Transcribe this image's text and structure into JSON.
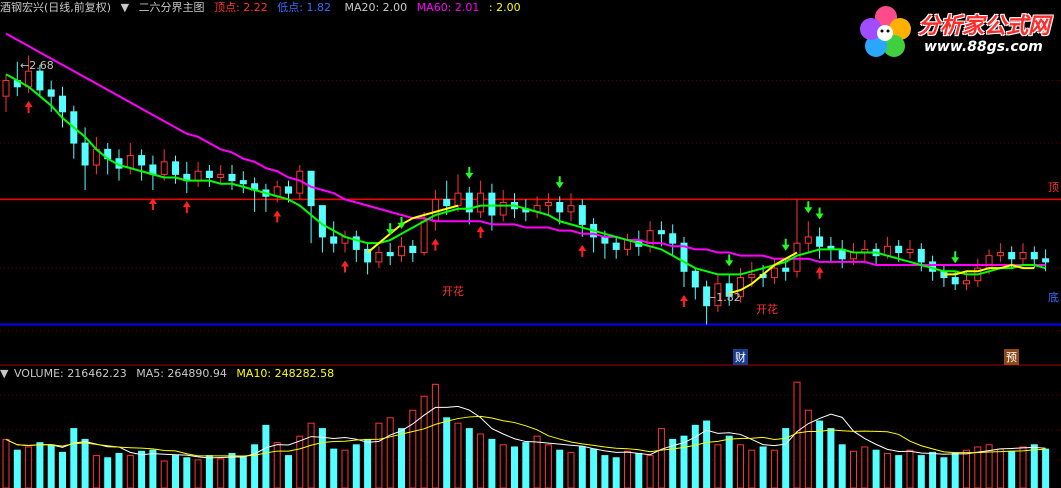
{
  "header": {
    "stock": "酒钢宏兴(日线,前复权)",
    "indicator": "二六分界主图",
    "top_label": "顶点: 2.22",
    "bottom_label": "低点: 1.82",
    "ma20_label": "MA20: 2.00",
    "ma60_label": "MA60: 2.01",
    "extra_label": ": 2.00"
  },
  "logo": {
    "title": "分析家公式网",
    "url": "www.88gs.com"
  },
  "annotations": {
    "high_price": "2.68",
    "low_price": "1.82",
    "kaihua_1": "开花",
    "kaihua_2": "开花",
    "top_tag": "顶",
    "bottom_tag": "底",
    "cai": "财",
    "yu": "预"
  },
  "volume_header": {
    "volume": "VOLUME: 216462.23",
    "ma5": "MA5: 264890.94",
    "ma10": "MA10: 248282.58"
  },
  "colors": {
    "up": "#ff3232",
    "down": "#54ffff",
    "ma20": "#00ff00",
    "ma60": "#ff00ff",
    "yellow_line": "#ffff00",
    "top_line": "#ff0000",
    "bottom_line": "#0000ff"
  },
  "chart_data": {
    "type": "candlestick",
    "ylim": [
      1.7,
      2.8
    ],
    "top_level": 2.22,
    "bottom_level": 1.82,
    "candles": [
      [
        2.55,
        2.6,
        2.5,
        2.62
      ],
      [
        2.6,
        2.58,
        2.55,
        2.66
      ],
      [
        2.58,
        2.63,
        2.56,
        2.68
      ],
      [
        2.63,
        2.57,
        2.55,
        2.65
      ],
      [
        2.57,
        2.55,
        2.5,
        2.6
      ],
      [
        2.55,
        2.5,
        2.45,
        2.58
      ],
      [
        2.5,
        2.4,
        2.35,
        2.52
      ],
      [
        2.4,
        2.33,
        2.25,
        2.45
      ],
      [
        2.33,
        2.38,
        2.3,
        2.42
      ],
      [
        2.38,
        2.35,
        2.3,
        2.4
      ],
      [
        2.35,
        2.32,
        2.28,
        2.38
      ],
      [
        2.32,
        2.36,
        2.3,
        2.4
      ],
      [
        2.36,
        2.33,
        2.28,
        2.38
      ],
      [
        2.33,
        2.3,
        2.25,
        2.36
      ],
      [
        2.3,
        2.34,
        2.28,
        2.38
      ],
      [
        2.34,
        2.3,
        2.27,
        2.36
      ],
      [
        2.3,
        2.28,
        2.24,
        2.34
      ],
      [
        2.28,
        2.31,
        2.26,
        2.34
      ],
      [
        2.31,
        2.29,
        2.26,
        2.33
      ],
      [
        2.29,
        2.3,
        2.27,
        2.33
      ],
      [
        2.3,
        2.28,
        2.25,
        2.33
      ],
      [
        2.28,
        2.27,
        2.24,
        2.31
      ],
      [
        2.27,
        2.25,
        2.18,
        2.29
      ],
      [
        2.25,
        2.23,
        2.18,
        2.27
      ],
      [
        2.23,
        2.26,
        2.21,
        2.28
      ],
      [
        2.26,
        2.24,
        2.21,
        2.28
      ],
      [
        2.24,
        2.31,
        2.22,
        2.33
      ],
      [
        2.31,
        2.2,
        2.08,
        2.31
      ],
      [
        2.2,
        2.1,
        2.05,
        2.2
      ],
      [
        2.1,
        2.08,
        2.05,
        2.15
      ],
      [
        2.08,
        2.1,
        2.05,
        2.12
      ],
      [
        2.1,
        2.06,
        2.02,
        2.12
      ],
      [
        2.06,
        2.02,
        1.98,
        2.08
      ],
      [
        2.02,
        2.05,
        2.0,
        2.07
      ],
      [
        2.05,
        2.04,
        2.01,
        2.08
      ],
      [
        2.04,
        2.07,
        2.02,
        2.1
      ],
      [
        2.07,
        2.05,
        2.02,
        2.09
      ],
      [
        2.05,
        2.15,
        2.04,
        2.18
      ],
      [
        2.15,
        2.22,
        2.12,
        2.25
      ],
      [
        2.22,
        2.2,
        2.17,
        2.28
      ],
      [
        2.2,
        2.24,
        2.18,
        2.3
      ],
      [
        2.24,
        2.18,
        2.14,
        2.26
      ],
      [
        2.18,
        2.24,
        2.16,
        2.28
      ],
      [
        2.24,
        2.17,
        2.12,
        2.27
      ],
      [
        2.17,
        2.21,
        2.15,
        2.25
      ],
      [
        2.21,
        2.19,
        2.16,
        2.24
      ],
      [
        2.19,
        2.18,
        2.15,
        2.22
      ],
      [
        2.18,
        2.2,
        2.16,
        2.23
      ],
      [
        2.2,
        2.21,
        2.17,
        2.24
      ],
      [
        2.21,
        2.18,
        2.14,
        2.23
      ],
      [
        2.18,
        2.2,
        2.15,
        2.24
      ],
      [
        2.2,
        2.14,
        2.1,
        2.22
      ],
      [
        2.14,
        2.1,
        2.05,
        2.16
      ],
      [
        2.1,
        2.08,
        2.03,
        2.12
      ],
      [
        2.08,
        2.06,
        2.03,
        2.1
      ],
      [
        2.06,
        2.09,
        2.04,
        2.11
      ],
      [
        2.09,
        2.07,
        2.04,
        2.12
      ],
      [
        2.07,
        2.12,
        2.05,
        2.15
      ],
      [
        2.12,
        2.11,
        2.07,
        2.15
      ],
      [
        2.11,
        2.08,
        2.04,
        2.14
      ],
      [
        2.08,
        1.99,
        1.94,
        2.1
      ],
      [
        1.99,
        1.94,
        1.9,
        2.0
      ],
      [
        1.94,
        1.88,
        1.82,
        1.96
      ],
      [
        1.88,
        1.95,
        1.86,
        1.98
      ],
      [
        1.95,
        1.91,
        1.88,
        1.98
      ],
      [
        1.91,
        1.97,
        1.89,
        2.0
      ],
      [
        1.97,
        1.98,
        1.94,
        2.02
      ],
      [
        1.98,
        1.97,
        1.94,
        2.01
      ],
      [
        1.97,
        2.0,
        1.95,
        2.03
      ],
      [
        2.0,
        1.99,
        1.96,
        2.03
      ],
      [
        1.99,
        2.08,
        1.97,
        2.22
      ],
      [
        2.08,
        2.1,
        2.05,
        2.15
      ],
      [
        2.1,
        2.07,
        2.03,
        2.13
      ],
      [
        2.07,
        2.06,
        2.02,
        2.1
      ],
      [
        2.06,
        2.03,
        2.0,
        2.09
      ],
      [
        2.03,
        2.05,
        2.01,
        2.08
      ],
      [
        2.05,
        2.06,
        2.02,
        2.09
      ],
      [
        2.06,
        2.04,
        2.01,
        2.08
      ],
      [
        2.04,
        2.07,
        2.03,
        2.1
      ],
      [
        2.07,
        2.05,
        2.02,
        2.09
      ],
      [
        2.05,
        2.06,
        2.03,
        2.09
      ],
      [
        2.06,
        2.02,
        1.99,
        2.08
      ],
      [
        2.02,
        1.99,
        1.96,
        2.04
      ],
      [
        1.99,
        1.97,
        1.94,
        2.01
      ],
      [
        1.97,
        1.95,
        1.93,
        1.99
      ],
      [
        1.95,
        1.96,
        1.93,
        1.99
      ],
      [
        1.96,
        2.0,
        1.94,
        2.03
      ],
      [
        2.0,
        2.04,
        1.98,
        2.06
      ],
      [
        2.04,
        2.05,
        2.02,
        2.08
      ],
      [
        2.05,
        2.03,
        2.0,
        2.07
      ],
      [
        2.03,
        2.05,
        2.01,
        2.08
      ],
      [
        2.05,
        2.03,
        2.0,
        2.07
      ],
      [
        2.03,
        2.02,
        1.99,
        2.06
      ]
    ],
    "ma20": [
      2.62,
      2.6,
      2.58,
      2.55,
      2.52,
      2.48,
      2.45,
      2.42,
      2.38,
      2.35,
      2.33,
      2.32,
      2.31,
      2.3,
      2.29,
      2.29,
      2.28,
      2.28,
      2.28,
      2.27,
      2.27,
      2.26,
      2.25,
      2.24,
      2.23,
      2.22,
      2.2,
      2.17,
      2.14,
      2.12,
      2.1,
      2.09,
      2.08,
      2.08,
      2.09,
      2.11,
      2.13,
      2.15,
      2.17,
      2.18,
      2.19,
      2.19,
      2.2,
      2.2,
      2.2,
      2.2,
      2.19,
      2.18,
      2.17,
      2.15,
      2.14,
      2.13,
      2.12,
      2.11,
      2.1,
      2.09,
      2.08,
      2.07,
      2.06,
      2.04,
      2.02,
      2.0,
      1.99,
      1.98,
      1.98,
      1.98,
      1.99,
      2.0,
      2.01,
      2.02,
      2.04,
      2.05,
      2.06,
      2.06,
      2.06,
      2.05,
      2.05,
      2.05,
      2.04,
      2.03,
      2.02,
      2.01,
      2.0,
      1.99,
      1.99,
      1.98,
      1.98,
      1.99,
      2.0,
      2.0,
      2.01,
      2.01,
      2.0
    ],
    "ma60": [
      2.75,
      2.73,
      2.71,
      2.69,
      2.67,
      2.65,
      2.63,
      2.61,
      2.59,
      2.57,
      2.55,
      2.53,
      2.51,
      2.49,
      2.47,
      2.45,
      2.43,
      2.42,
      2.4,
      2.38,
      2.37,
      2.35,
      2.34,
      2.32,
      2.31,
      2.29,
      2.28,
      2.26,
      2.25,
      2.24,
      2.22,
      2.21,
      2.2,
      2.19,
      2.18,
      2.17,
      2.16,
      2.16,
      2.15,
      2.15,
      2.15,
      2.15,
      2.15,
      2.14,
      2.14,
      2.14,
      2.13,
      2.13,
      2.13,
      2.12,
      2.12,
      2.11,
      2.11,
      2.1,
      2.1,
      2.09,
      2.09,
      2.08,
      2.08,
      2.07,
      2.07,
      2.06,
      2.06,
      2.05,
      2.05,
      2.04,
      2.04,
      2.04,
      2.03,
      2.03,
      2.03,
      2.03,
      2.02,
      2.02,
      2.02,
      2.02,
      2.02,
      2.01,
      2.01,
      2.01,
      2.01,
      2.01,
      2.01,
      2.01,
      2.01,
      2.01,
      2.01,
      2.01,
      2.01,
      2.01,
      2.01,
      2.01,
      2.01
    ],
    "yellow_segments": [
      {
        "start": 32,
        "values": [
          2.05,
          2.08,
          2.11,
          2.14,
          2.16,
          2.17,
          2.18,
          2.19,
          2.2
        ]
      },
      {
        "start": 64,
        "values": [
          1.92,
          1.93,
          1.95,
          1.98,
          2.01,
          2.03,
          2.05
        ]
      },
      {
        "start": 83,
        "values": [
          1.98,
          1.98,
          1.99,
          1.99,
          2.0,
          2.0,
          2.01,
          2.0,
          2.0
        ]
      }
    ],
    "buy_arrows": [
      2,
      13,
      16,
      24,
      30,
      38,
      42,
      51,
      60,
      72
    ],
    "sell_arrows": [
      34,
      35,
      41,
      49,
      64,
      69,
      71,
      72,
      84
    ],
    "volume": [
      0.45,
      0.35,
      0.38,
      0.42,
      0.4,
      0.33,
      0.55,
      0.45,
      0.3,
      0.28,
      0.32,
      0.3,
      0.34,
      0.35,
      0.25,
      0.3,
      0.28,
      0.26,
      0.3,
      0.27,
      0.32,
      0.29,
      0.4,
      0.58,
      0.42,
      0.3,
      0.48,
      0.6,
      0.55,
      0.36,
      0.35,
      0.4,
      0.45,
      0.6,
      0.65,
      0.55,
      0.72,
      0.85,
      0.96,
      0.65,
      0.6,
      0.55,
      0.5,
      0.45,
      0.4,
      0.38,
      0.42,
      0.48,
      0.4,
      0.35,
      0.33,
      0.38,
      0.36,
      0.3,
      0.28,
      0.34,
      0.32,
      0.3,
      0.55,
      0.45,
      0.48,
      0.58,
      0.62,
      0.4,
      0.48,
      0.4,
      0.35,
      0.38,
      0.35,
      0.55,
      0.98,
      0.72,
      0.62,
      0.55,
      0.4,
      0.34,
      0.38,
      0.35,
      0.32,
      0.3,
      0.35,
      0.3,
      0.33,
      0.28,
      0.32,
      0.35,
      0.38,
      0.4,
      0.36,
      0.34,
      0.38,
      0.4,
      0.36
    ],
    "volume_up": [
      1,
      0,
      1,
      0,
      0,
      0,
      0,
      0,
      1,
      0,
      0,
      1,
      0,
      0,
      1,
      0,
      0,
      1,
      0,
      1,
      0,
      0,
      0,
      0,
      1,
      0,
      1,
      1,
      0,
      0,
      1,
      0,
      0,
      1,
      1,
      0,
      1,
      1,
      1,
      0,
      1,
      0,
      1,
      0,
      1,
      0,
      0,
      1,
      1,
      0,
      1,
      0,
      0,
      0,
      0,
      1,
      0,
      1,
      1,
      0,
      0,
      0,
      0,
      1,
      0,
      1,
      1,
      0,
      1,
      0,
      1,
      1,
      0,
      0,
      0,
      1,
      1,
      0,
      1,
      0,
      1,
      0,
      0,
      0,
      0,
      1,
      1,
      1,
      1,
      0,
      1,
      0,
      0
    ]
  }
}
